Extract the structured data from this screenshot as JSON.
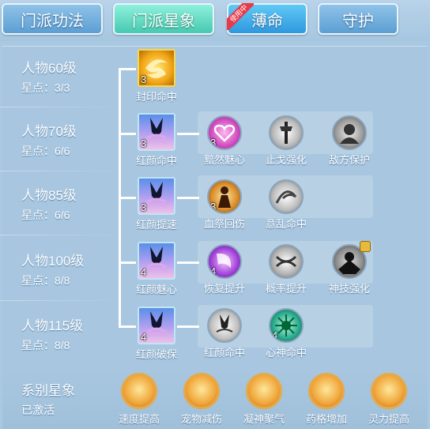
{
  "tabs": [
    {
      "label": "门派功法"
    },
    {
      "label": "门派星象"
    },
    {
      "label": "薄命",
      "badge": "使用中"
    },
    {
      "label": "守护"
    }
  ],
  "levels": [
    {
      "name": "人物60级",
      "stars": "星点：3/3"
    },
    {
      "name": "人物70级",
      "stars": "星点：6/6"
    },
    {
      "name": "人物85级",
      "stars": "星点：6/6"
    },
    {
      "name": "人物100级",
      "stars": "星点：8/8"
    },
    {
      "name": "人物115级",
      "stars": "星点：8/8"
    }
  ],
  "rows": [
    {
      "main": {
        "label": "封印命中",
        "count": "3"
      },
      "subs": []
    },
    {
      "main": {
        "label": "红颜命中",
        "count": "3"
      },
      "subs": [
        {
          "label": "黯然魅心",
          "count": "3"
        },
        {
          "label": "止戈强化",
          "count": ""
        },
        {
          "label": "敌方保护",
          "count": ""
        }
      ]
    },
    {
      "main": {
        "label": "红颜提速",
        "count": "3"
      },
      "subs": [
        {
          "label": "血祭回伤",
          "count": "3"
        },
        {
          "label": "意乱命中",
          "count": ""
        }
      ]
    },
    {
      "main": {
        "label": "红颜魅心",
        "count": "4"
      },
      "subs": [
        {
          "label": "恢复提升",
          "count": "4"
        },
        {
          "label": "概率提升",
          "count": ""
        },
        {
          "label": "神技强化",
          "count": ""
        }
      ]
    },
    {
      "main": {
        "label": "红颜破保",
        "count": "4"
      },
      "subs": [
        {
          "label": "红颜命中",
          "count": ""
        },
        {
          "label": "心神命中",
          "count": "4"
        }
      ]
    }
  ],
  "system": {
    "title": "系别星象",
    "status": "已激活"
  },
  "bottom_icons": [
    {
      "label": "速度提高"
    },
    {
      "label": "宠物减伤"
    },
    {
      "label": "凝神聚气"
    },
    {
      "label": "药格增加"
    },
    {
      "label": "灵力提高"
    }
  ],
  "colors": {
    "accent_active_tab": "#47c9b0",
    "tab": "#5c9fd3",
    "badge": "#e83a4a"
  }
}
